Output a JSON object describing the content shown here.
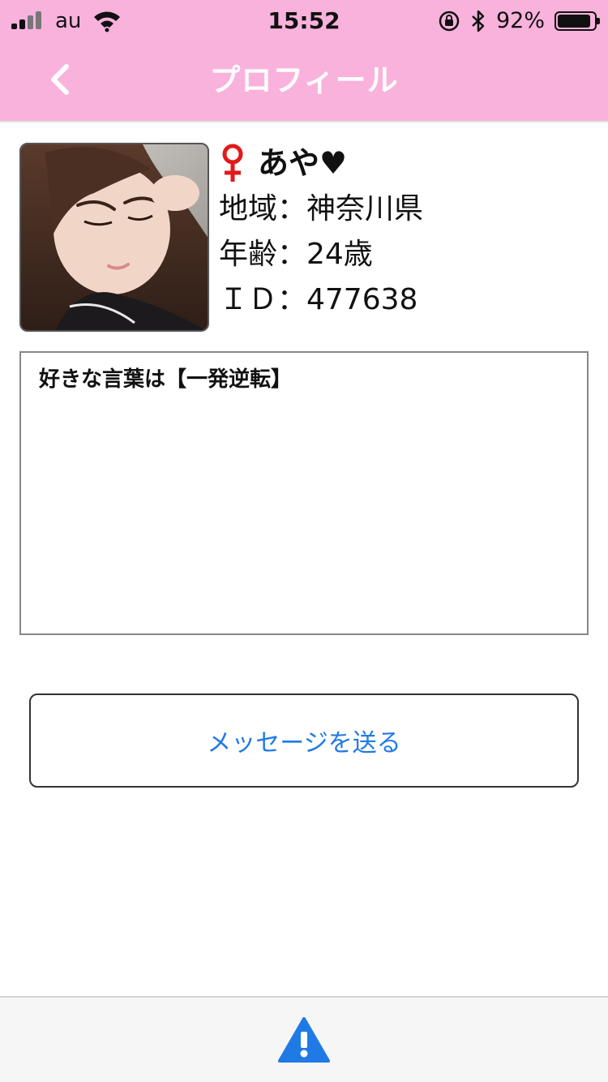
{
  "status_bar": {
    "carrier": "au",
    "time": "15:52",
    "battery_percent": "92%",
    "battery_level": 0.92,
    "icons": [
      "signal-icon",
      "wifi-icon",
      "orientation-lock-icon",
      "bluetooth-icon",
      "battery-icon"
    ]
  },
  "nav": {
    "title": "プロフィール",
    "back_icon": "chevron-left-icon",
    "background_color": "#f9b2dc"
  },
  "profile": {
    "gender_icon": "female-symbol-icon",
    "name": "あや♥",
    "region": "地域：神奈川県",
    "age": "年齢：24歳",
    "id": "ＩＤ：477638"
  },
  "bio": {
    "text": "好きな言葉は【一発逆転】"
  },
  "actions": {
    "send_message_label": "メッセージを送る",
    "link_color": "#1f7ae6"
  },
  "footer": {
    "report_icon": "warning-icon",
    "report_color": "#1f7ae6"
  }
}
